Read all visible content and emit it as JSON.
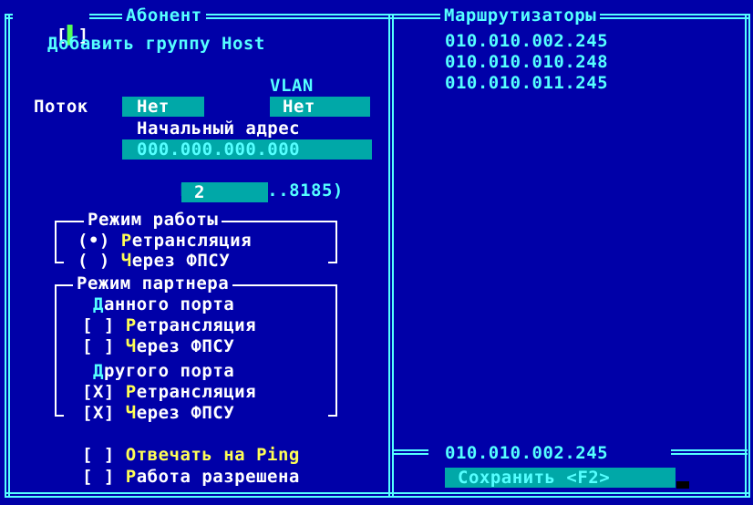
{
  "window": {
    "close_marker": "[▌]"
  },
  "left_panel": {
    "title": "Абонент",
    "heading": "Добавить группу Host",
    "vlan_label": "VLAN",
    "stream_label": "Поток",
    "stream_value": "Нет",
    "vlan_value": "Нет",
    "start_addr_label": "Начальный адрес",
    "start_addr_value": "000.000.000.000",
    "total_label": "Всего (2..8185)",
    "total_value": "2",
    "mode_group": {
      "title": "Режим работы",
      "options": [
        {
          "mark": "(•)",
          "hot": "Р",
          "rest": "етрансляция"
        },
        {
          "mark": "( )",
          "hot": "Ч",
          "rest": "ерез ФПСУ"
        }
      ]
    },
    "partner_group": {
      "title": "Режим партнера",
      "this_port": {
        "hot": "Д",
        "rest": "анного порта"
      },
      "this_port_options": [
        {
          "mark": "[ ]",
          "hot": "Р",
          "rest": "етрансляция"
        },
        {
          "mark": "[ ]",
          "hot": "Ч",
          "rest": "ерез ФПСУ"
        }
      ],
      "other_port": {
        "hot": "Д",
        "rest": "ругого порта"
      },
      "other_port_options": [
        {
          "mark": "[X]",
          "hot": "Р",
          "rest": "етрансляция"
        },
        {
          "mark": "[X]",
          "hot": "Ч",
          "rest": "ерез ФПСУ"
        }
      ]
    },
    "ping": {
      "mark": "[ ]",
      "text": "Отвечать на ",
      "hot": "Ping"
    },
    "enabled": {
      "mark": "[ ]",
      "hot": "Р",
      "rest": "абота разрешена"
    }
  },
  "right_panel": {
    "title": "Маршрутизаторы",
    "routers": [
      "010.010.002.245",
      "010.010.010.248",
      "010.010.011.245"
    ],
    "selected_router": "010.010.002.245",
    "save_button": "Сохранить <F2>"
  },
  "colors": {
    "background": "#0000a8",
    "frame": "#55ffff",
    "field": "#00a8a8",
    "hotkey": "#ffff55",
    "text": "#ffffff"
  }
}
